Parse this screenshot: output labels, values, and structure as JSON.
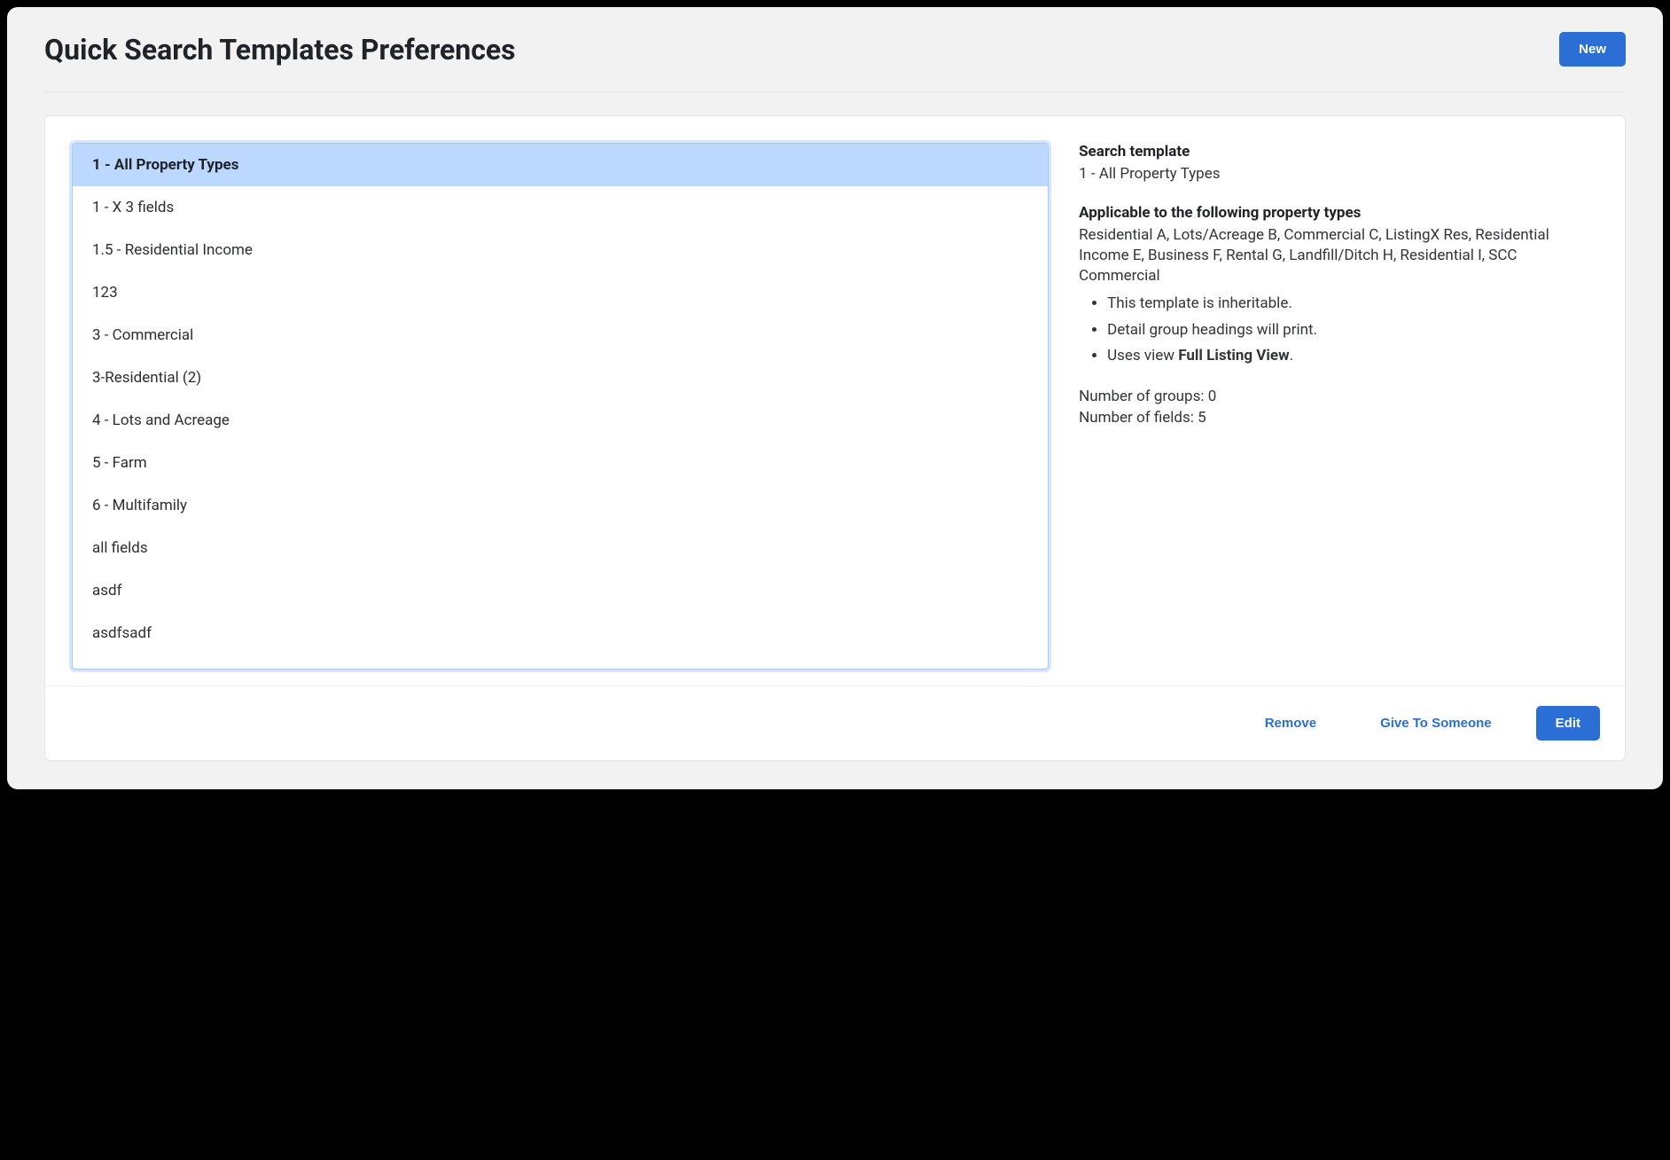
{
  "header": {
    "title": "Quick Search Templates Preferences",
    "new_button": "New"
  },
  "list": {
    "items": [
      "1 - All Property Types",
      "1 - X 3 fields",
      "1.5 - Residential Income",
      "123",
      "3 - Commercial",
      "3-Residential (2)",
      "4 - Lots and Acreage",
      "5 - Farm",
      "6 - Multifamily",
      "all fields",
      "asdf",
      "asdfsadf"
    ],
    "selected_index": 0
  },
  "detail": {
    "template_label": "Search template",
    "template_name": "1 - All Property Types",
    "applicable_label": "Applicable to the following property types",
    "applicable_text": "Residential A, Lots/Acreage B, Commercial C, ListingX Res, Residential Income E, Business F, Rental G, Landfill/Ditch H, Residential I, SCC Commercial",
    "bullets": {
      "b0": "This template is inheritable.",
      "b1": "Detail group headings will print.",
      "b2_prefix": "Uses view ",
      "b2_view": "Full Listing View",
      "b2_suffix": "."
    },
    "groups_label": "Number of groups: ",
    "groups_value": "0",
    "fields_label": "Number of fields: ",
    "fields_value": "5"
  },
  "footer": {
    "remove": "Remove",
    "give": "Give To Someone",
    "edit": "Edit"
  }
}
